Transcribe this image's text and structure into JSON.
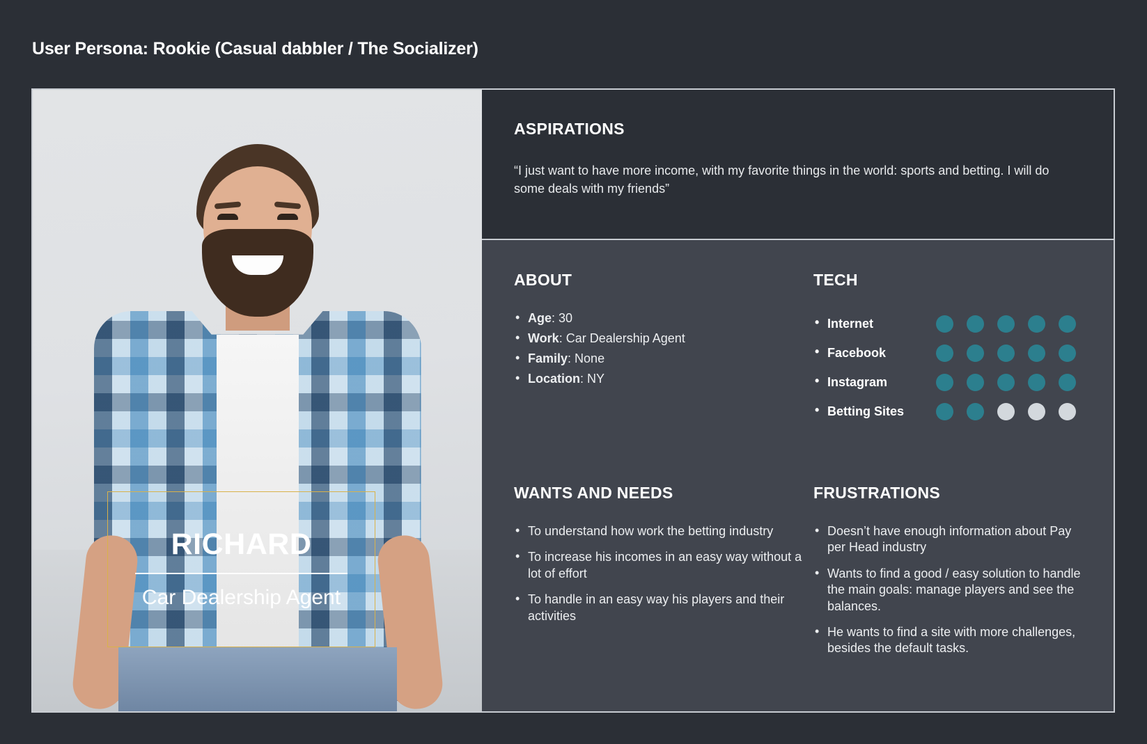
{
  "page": {
    "title": "User Persona: Rookie (Casual dabbler / The Socializer)",
    "background_color": "#2b2f36",
    "panel_color": "#41454e",
    "accent_color": "#2c7f8e",
    "border_color": "#c8ccd2",
    "overlay_border_color": "#d9b24a"
  },
  "persona": {
    "name": "RICHARD",
    "role": "Car Dealership Agent"
  },
  "aspirations": {
    "heading": "ASPIRATIONS",
    "quote": "“I just want to have more income, with my favorite things in the world: sports and betting. I will do some deals with my friends”"
  },
  "about": {
    "heading": "ABOUT",
    "items": [
      {
        "label": "Age",
        "value": "30"
      },
      {
        "label": "Work",
        "value": "Car Dealership Agent"
      },
      {
        "label": "Family",
        "value": "None"
      },
      {
        "label": "Location",
        "value": "NY"
      }
    ]
  },
  "tech": {
    "heading": "TECH",
    "max_rating": 5,
    "items": [
      {
        "label": "Internet",
        "rating": 5
      },
      {
        "label": "Facebook",
        "rating": 5
      },
      {
        "label": "Instagram",
        "rating": 5
      },
      {
        "label": "Betting Sites",
        "rating": 2
      }
    ]
  },
  "wants_and_needs": {
    "heading": "WANTS AND NEEDS",
    "items": [
      "To understand how work the betting industry",
      "To increase his incomes in an easy way without a lot of effort",
      "To handle in an easy way his players and their activities"
    ]
  },
  "frustrations": {
    "heading": "FRUSTRATIONS",
    "items": [
      "Doesn’t have enough information about Pay per Head industry",
      "Wants to find a good / easy solution to handle the main goals: manage players and see the balances.",
      "He wants to find a site with more challenges, besides the default tasks."
    ]
  }
}
